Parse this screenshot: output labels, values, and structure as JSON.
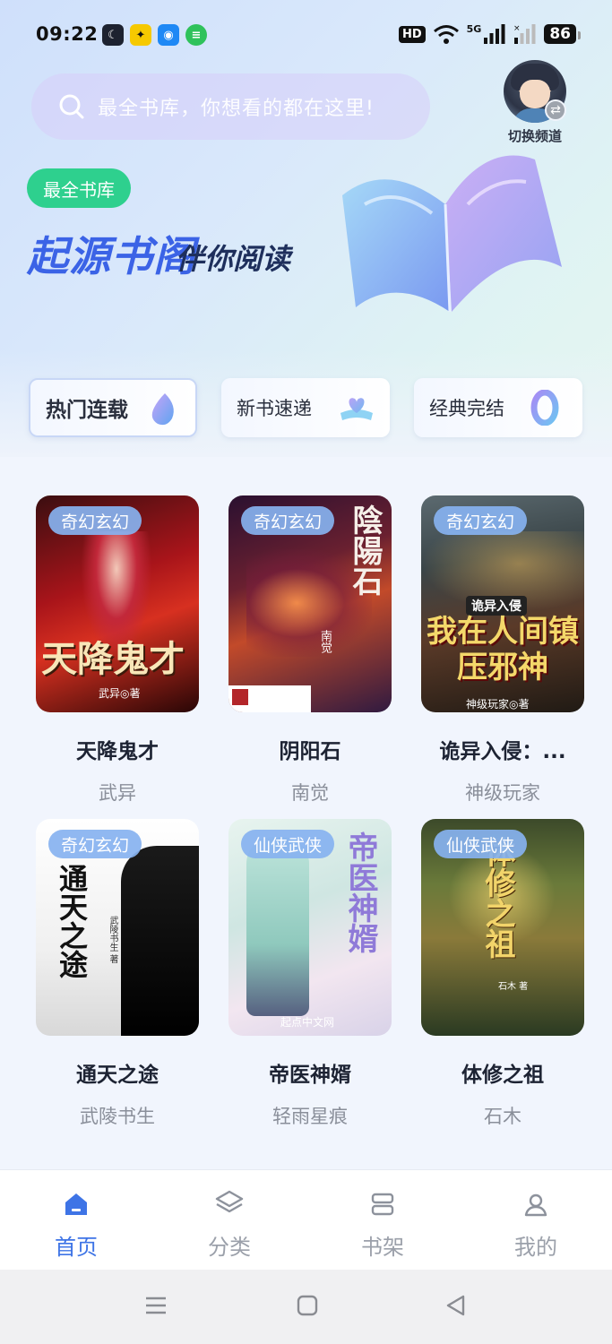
{
  "status_bar": {
    "time": "09:22",
    "hd_label": "HD",
    "network_label": "5G",
    "battery": "86"
  },
  "search": {
    "placeholder": "最全书库，你想看的都在这里!"
  },
  "channel_switch": {
    "label": "切换频道"
  },
  "banner": {
    "tag": "最全书库",
    "title": "起源书阁",
    "subtitle": "伴你阅读"
  },
  "categories": [
    {
      "label": "热门连载",
      "active": true,
      "icon": "flame-drop-icon"
    },
    {
      "label": "新书速递",
      "active": false,
      "icon": "heart-book-icon"
    },
    {
      "label": "经典完结",
      "active": false,
      "icon": "ring-icon"
    }
  ],
  "books": [
    {
      "genre": "奇幻玄幻",
      "title": "天降鬼才",
      "author": "武异",
      "cover_text": "天降鬼才",
      "cover_author": "武异◎著"
    },
    {
      "genre": "奇幻玄幻",
      "title": "阴阳石",
      "author": "南觉",
      "cover_text": "陰陽石",
      "cover_author": "南觉"
    },
    {
      "genre": "奇幻玄幻",
      "title": "诡异入侵：...",
      "author": "神级玩家",
      "cover_text": "我在人间镇压邪神",
      "cover_author": "神级玩家◎著",
      "cover_top_text": "诡异入侵"
    },
    {
      "genre": "奇幻玄幻",
      "title": "通天之途",
      "author": "武陵书生",
      "cover_text": "通天之途",
      "cover_author": "武陵书生 著"
    },
    {
      "genre": "仙侠武侠",
      "title": "帝医神婿",
      "author": "轻雨星痕",
      "cover_text": "帝医神婿",
      "cover_author": "起点中文网"
    },
    {
      "genre": "仙侠武侠",
      "title": "体修之祖",
      "author": "石木",
      "cover_text": "体修之祖",
      "cover_author": "石木 著"
    }
  ],
  "bottom_nav": [
    {
      "label": "首页",
      "icon": "home-icon",
      "active": true
    },
    {
      "label": "分类",
      "icon": "layers-icon",
      "active": false
    },
    {
      "label": "书架",
      "icon": "bookshelf-icon",
      "active": false
    },
    {
      "label": "我的",
      "icon": "user-icon",
      "active": false
    }
  ],
  "colors": {
    "accent": "#3e74e6",
    "tag_green": "#2ed08e",
    "genre_badge": "#87b2f0",
    "title_blue": "#3b63e6"
  }
}
